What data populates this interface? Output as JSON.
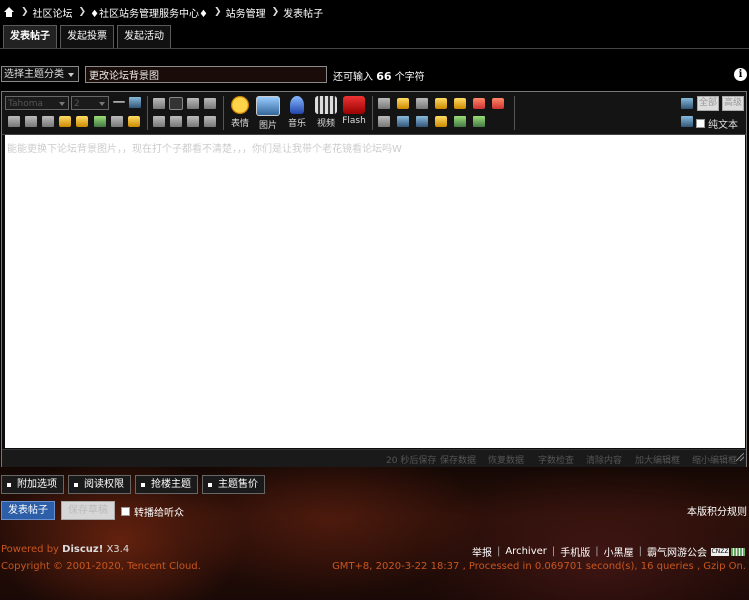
{
  "breadcrumb": {
    "items": [
      "社区论坛",
      "♦社区站务管理服务中心♦",
      "站务管理",
      "发表帖子"
    ]
  },
  "tabs": [
    {
      "label": "发表帖子",
      "active": true
    },
    {
      "label": "发起投票",
      "active": false
    },
    {
      "label": "发起活动",
      "active": false
    }
  ],
  "subject": {
    "category_select": "选择主题分类",
    "title_value": "更改论坛背景图",
    "remaining_prefix": "还可输入",
    "remaining_count": "66",
    "remaining_suffix": "个字符"
  },
  "toolbar": {
    "font_select": "Tahoma",
    "size_select": "2",
    "big_buttons": [
      "表情",
      "图片",
      "音乐",
      "视频",
      "Flash"
    ],
    "plain_text_label": "纯文本",
    "right_btn_1": "全部",
    "right_btn_2": "高级"
  },
  "editor": {
    "content": "能能更换下论坛背景图片，，现在打个子都看不清楚，，，你们是让我带个老花镜看论坛吗W"
  },
  "status_bar": {
    "autosave": "20 秒后保存",
    "save": "保存数据",
    "restore": "恢复数据",
    "check": "字数检查",
    "clear": "清除内容",
    "enlarge": "加大编辑框",
    "shrink": "缩小编辑框"
  },
  "options": [
    "附加选项",
    "阅读权限",
    "抢楼主题",
    "主题售价"
  ],
  "actions": {
    "submit": "发表帖子",
    "draft": "保存草稿",
    "forward": "转播给听众",
    "rules": "本版积分规则"
  },
  "footer": {
    "powered_by": "Powered by",
    "product": "Discuz!",
    "version": "X3.4",
    "copyright": "Copyright © 2001-2020, Tencent Cloud.",
    "links": [
      "举报",
      "Archiver",
      "手机版",
      "小黑屋",
      "霸气网游公会"
    ],
    "cnzz": "CNZZ",
    "gmt": "GMT+8, 2020-3-22 18:37 , Processed in 0.069701 second(s), 16 queries , Gzip On."
  },
  "colors": {
    "accent_orange": "#c8561e",
    "submit_blue": "#2d5fa8"
  }
}
